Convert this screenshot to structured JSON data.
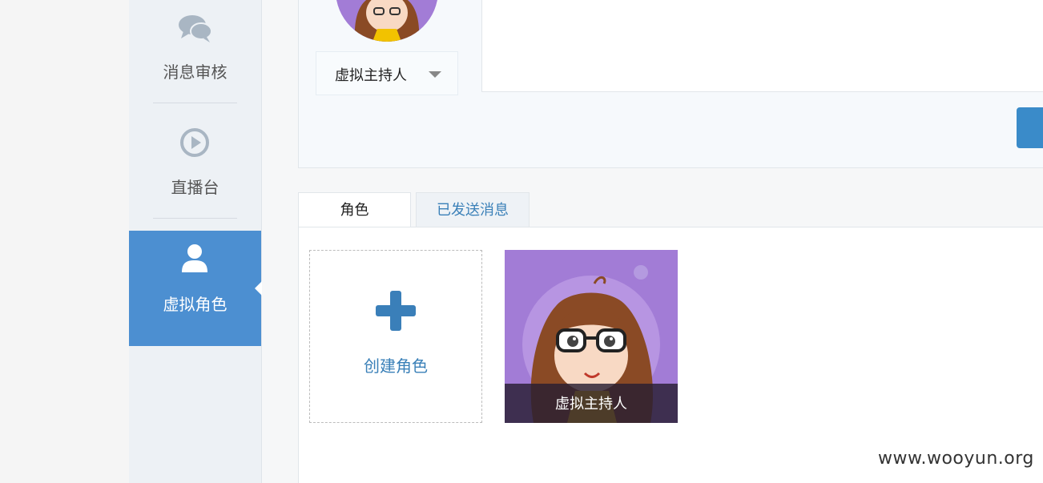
{
  "sidebar": {
    "items": [
      {
        "label": "消息审核",
        "icon": "chat-bubbles-icon"
      },
      {
        "label": "直播台",
        "icon": "play-circle-icon"
      },
      {
        "label": "虚拟角色",
        "icon": "user-icon",
        "active": true
      }
    ]
  },
  "composer": {
    "selected_role": "虚拟主持人"
  },
  "tabs": [
    {
      "label": "角色",
      "active": true
    },
    {
      "label": "已发送消息",
      "active": false
    }
  ],
  "roles_panel": {
    "create_label": "创建角色",
    "cards": [
      {
        "name": "虚拟主持人"
      }
    ]
  },
  "watermark": "www.wooyun.org",
  "colors": {
    "accent": "#4c8fd1",
    "link": "#3a80b8",
    "avatar_bg": "#a27cd6"
  }
}
